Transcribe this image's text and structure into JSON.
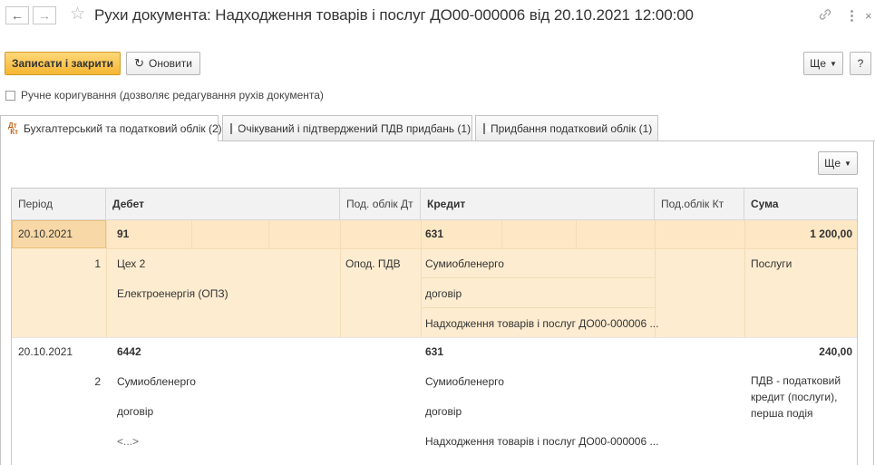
{
  "window": {
    "title": "Рухи документа: Надходження товарів і послуг ДО00-000006 від 20.10.2021 12:00:00"
  },
  "toolbar": {
    "save_close_label": "Записати і закрити",
    "refresh_label": "Оновити",
    "more_label": "Ще",
    "help_label": "?"
  },
  "manual_edit": {
    "label": "Ручне коригування (дозволяє редагування рухів документа)",
    "checked": false
  },
  "tabs": [
    {
      "label": "Бухгалтерський та податковий облік (2)",
      "active": true
    },
    {
      "label": "Очікуваний і підтверджений ПДВ придбань (1)",
      "active": false
    },
    {
      "label": "Придбання податковий облік (1)",
      "active": false
    }
  ],
  "table_toolbar": {
    "more_label": "Ще"
  },
  "table": {
    "columns": [
      "Період",
      "Дебет",
      "Под. облік Дт",
      "Кредит",
      "Под.облік Кт",
      "Сума"
    ],
    "rows": [
      {
        "period": "20.10.2021",
        "number": "1",
        "debit": "91",
        "debit_sub1": "Цех 2",
        "debit_sub2": "Електроенергія (ОПЗ)",
        "debit_sub3": "",
        "tax_debit": "Опод. ПДВ",
        "credit": "631",
        "credit_sub1": "Сумиобленерго",
        "credit_sub2": "договір",
        "credit_sub3": "Надходження товарів і послуг ДО00-000006 ...",
        "tax_credit": "",
        "amount": "1 200,00",
        "content": "Послуги"
      },
      {
        "period": "20.10.2021",
        "number": "2",
        "debit": "6442",
        "debit_sub1": "Сумиобленерго",
        "debit_sub2": "договір",
        "debit_sub3": "<...>",
        "tax_debit": "",
        "credit": "631",
        "credit_sub1": "Сумиобленерго",
        "credit_sub2": "договір",
        "credit_sub3": "Надходження товарів і послуг ДО00-000006 ...",
        "tax_credit": "",
        "amount": "240,00",
        "content_lines": [
          "ПДВ - податковий",
          "кредит (послуги),",
          "перша подія"
        ]
      }
    ]
  },
  "colors": {
    "primary_button": "#f5b631",
    "selected_row": "#fdecd0",
    "selected_row_light": "#fff6e6"
  }
}
